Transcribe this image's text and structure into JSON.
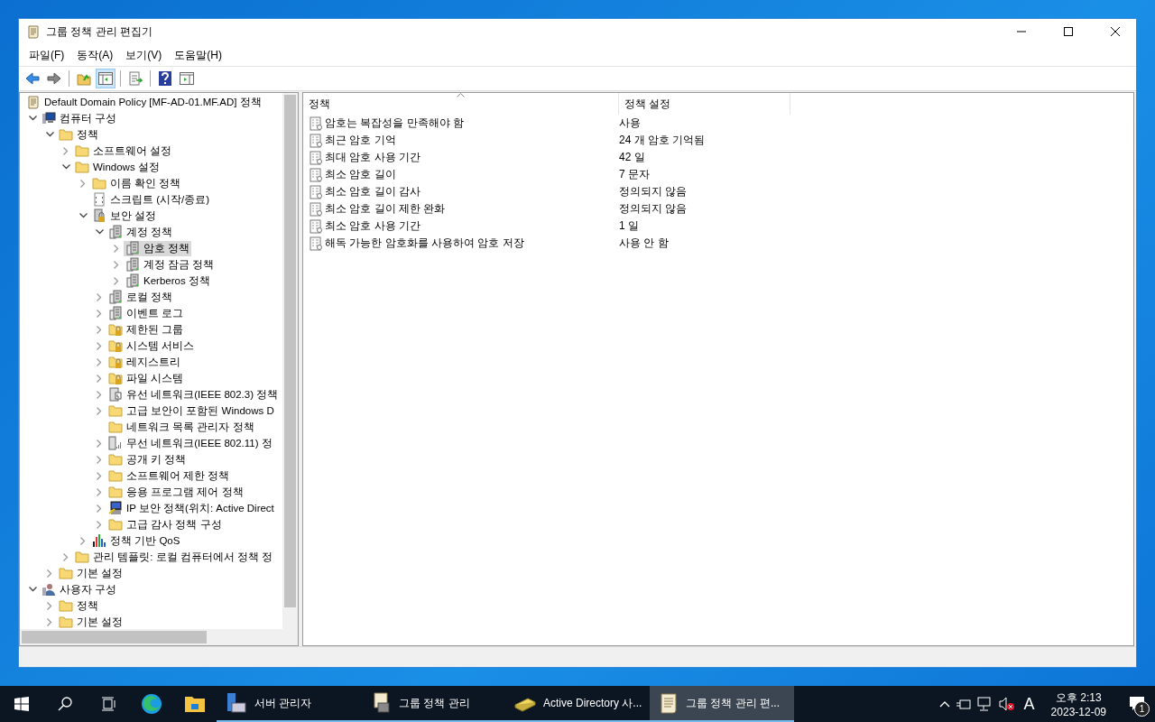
{
  "window": {
    "title": "그룹 정책 관리 편집기"
  },
  "menu": [
    "파일(F)",
    "동작(A)",
    "보기(V)",
    "도움말(H)"
  ],
  "tree": {
    "label": "Default Domain Policy [MF-AD-01.MF.AD] 정책",
    "kind": "scroll",
    "selected": false,
    "children": [
      {
        "label": "컴퓨터 구성",
        "kind": "computer",
        "expanded": true,
        "selected": false,
        "children": [
          {
            "label": "정책",
            "kind": "folder",
            "expanded": true,
            "selected": false,
            "children": [
              {
                "label": "소프트웨어 설정",
                "kind": "folder",
                "expanded": false,
                "selected": false
              },
              {
                "label": "Windows 설정",
                "kind": "folder",
                "expanded": true,
                "selected": false,
                "children": [
                  {
                    "label": "이름 확인 정책",
                    "kind": "folder",
                    "expanded": false,
                    "selected": false
                  },
                  {
                    "label": "스크립트 (시작/종료)",
                    "kind": "script",
                    "selected": false
                  },
                  {
                    "label": "보안 설정",
                    "kind": "lock-server",
                    "expanded": true,
                    "selected": false,
                    "children": [
                      {
                        "label": "계정 정책",
                        "kind": "server",
                        "expanded": true,
                        "selected": false,
                        "children": [
                          {
                            "label": "암호 정책",
                            "kind": "server",
                            "expanded": false,
                            "selected": true
                          },
                          {
                            "label": "계정 잠금 정책",
                            "kind": "server",
                            "expanded": false,
                            "selected": false
                          },
                          {
                            "label": "Kerberos 정책",
                            "kind": "server",
                            "expanded": false,
                            "selected": false
                          }
                        ]
                      },
                      {
                        "label": "로컬 정책",
                        "kind": "server",
                        "expanded": false,
                        "selected": false
                      },
                      {
                        "label": "이벤트 로그",
                        "kind": "server",
                        "expanded": false,
                        "selected": false
                      },
                      {
                        "label": "제한된 그룹",
                        "kind": "lock-folder",
                        "expanded": false,
                        "selected": false
                      },
                      {
                        "label": "시스템 서비스",
                        "kind": "lock-folder",
                        "expanded": false,
                        "selected": false
                      },
                      {
                        "label": "레지스트리",
                        "kind": "lock-folder",
                        "expanded": false,
                        "selected": false
                      },
                      {
                        "label": "파일 시스템",
                        "kind": "lock-folder",
                        "expanded": false,
                        "selected": false
                      },
                      {
                        "label": "유선 네트워크(IEEE 802.3) 정책",
                        "kind": "wired",
                        "expanded": false,
                        "selected": false
                      },
                      {
                        "label": "고급 보안이 포함된 Windows D",
                        "kind": "folder",
                        "expanded": false,
                        "selected": false
                      },
                      {
                        "label": "네트워크 목록 관리자 정책",
                        "kind": "folder",
                        "selected": false
                      },
                      {
                        "label": "무선 네트워크(IEEE 802.11) 정",
                        "kind": "wireless",
                        "expanded": false,
                        "selected": false
                      },
                      {
                        "label": "공개 키 정책",
                        "kind": "folder",
                        "expanded": false,
                        "selected": false
                      },
                      {
                        "label": "소프트웨어 제한 정책",
                        "kind": "folder",
                        "expanded": false,
                        "selected": false
                      },
                      {
                        "label": "응용 프로그램 제어 정책",
                        "kind": "folder",
                        "expanded": false,
                        "selected": false
                      },
                      {
                        "label": "IP 보안 정책(위치: Active Direct",
                        "kind": "ipsec",
                        "expanded": false,
                        "selected": false
                      },
                      {
                        "label": "고급 감사 정책 구성",
                        "kind": "folder",
                        "expanded": false,
                        "selected": false
                      }
                    ]
                  },
                  {
                    "label": "정책 기반 QoS",
                    "kind": "chart",
                    "expanded": false,
                    "selected": false
                  }
                ]
              },
              {
                "label": "관리 템플릿: 로컬 컴퓨터에서 정책 정",
                "kind": "folder",
                "expanded": false,
                "selected": false
              }
            ]
          },
          {
            "label": "기본 설정",
            "kind": "folder",
            "expanded": false,
            "selected": false
          }
        ]
      },
      {
        "label": "사용자 구성",
        "kind": "user",
        "expanded": true,
        "selected": false,
        "children": [
          {
            "label": "정책",
            "kind": "folder",
            "expanded": false,
            "selected": false
          },
          {
            "label": "기본 설정",
            "kind": "folder",
            "expanded": false,
            "selected": false
          }
        ]
      }
    ]
  },
  "list": {
    "columns": [
      "정책",
      "정책 설정"
    ],
    "rows": [
      {
        "policy": "암호는 복잡성을 만족해야 함",
        "setting": "사용"
      },
      {
        "policy": "최근 암호 기억",
        "setting": "24 개 암호 기억됨"
      },
      {
        "policy": "최대 암호 사용 기간",
        "setting": "42 일"
      },
      {
        "policy": "최소 암호 길이",
        "setting": "7 문자"
      },
      {
        "policy": "최소 암호 길이 감사",
        "setting": "정의되지 않음"
      },
      {
        "policy": "최소 암호 길이 제한 완화",
        "setting": "정의되지 않음"
      },
      {
        "policy": "최소 암호 사용 기간",
        "setting": "1 일"
      },
      {
        "policy": "해독 가능한 암호화를 사용하여 암호 저장",
        "setting": "사용 안 함"
      }
    ]
  },
  "taskbar": {
    "apps": [
      {
        "label": "서버 관리자",
        "kind": "server-manager",
        "selected": false
      },
      {
        "label": "그룹 정책 관리",
        "kind": "gpm",
        "selected": false
      },
      {
        "label": "Active Directory 사...",
        "kind": "ad",
        "selected": false
      },
      {
        "label": "그룹 정책 관리 편...",
        "kind": "scroll",
        "selected": true
      }
    ],
    "ime": "A",
    "time": "오후 2:13",
    "date": "2023-12-09",
    "notifications": "1"
  }
}
